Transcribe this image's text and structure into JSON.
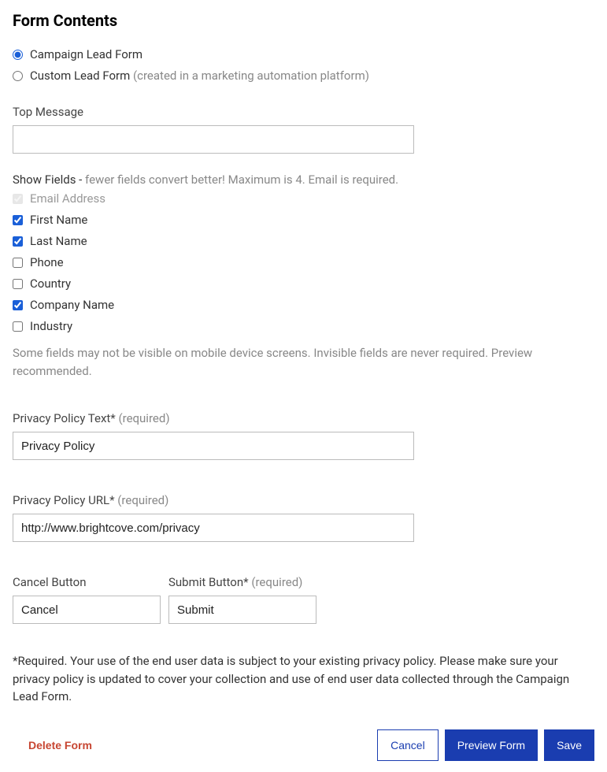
{
  "title": "Form Contents",
  "formType": {
    "campaign": {
      "label": "Campaign Lead Form",
      "checked": true
    },
    "custom": {
      "label": "Custom Lead Form ",
      "hint": "(created in a marketing automation platform)",
      "checked": false
    }
  },
  "topMessage": {
    "label": "Top Message",
    "value": ""
  },
  "showFields": {
    "label": "Show Fields -",
    "hint": " fewer fields convert better! Maximum is 4. Email is required.",
    "items": [
      {
        "label": "Email Address",
        "checked": true,
        "disabled": true
      },
      {
        "label": "First Name",
        "checked": true,
        "disabled": false
      },
      {
        "label": "Last Name",
        "checked": true,
        "disabled": false
      },
      {
        "label": "Phone",
        "checked": false,
        "disabled": false
      },
      {
        "label": "Country",
        "checked": false,
        "disabled": false
      },
      {
        "label": "Company Name",
        "checked": true,
        "disabled": false
      },
      {
        "label": "Industry",
        "checked": false,
        "disabled": false
      }
    ],
    "help": "Some fields may not be visible on mobile device screens. Invisible fields are never required. Preview recommended."
  },
  "privacyText": {
    "label": "Privacy Policy Text* ",
    "required": "(required)",
    "value": "Privacy Policy"
  },
  "privacyUrl": {
    "label": "Privacy Policy URL* ",
    "required": "(required)",
    "value": "http://www.brightcove.com/privacy"
  },
  "cancelBtn": {
    "label": "Cancel Button",
    "value": "Cancel"
  },
  "submitBtn": {
    "label": "Submit Button* ",
    "required": "(required)",
    "value": "Submit"
  },
  "disclaimer": "*Required. Your use of the end user data is subject to your existing privacy policy. Please make sure your privacy policy is updated to cover your collection and use of end user data collected through the Campaign Lead Form.",
  "actions": {
    "delete": "Delete Form",
    "cancel": "Cancel",
    "preview": "Preview Form",
    "save": "Save"
  }
}
